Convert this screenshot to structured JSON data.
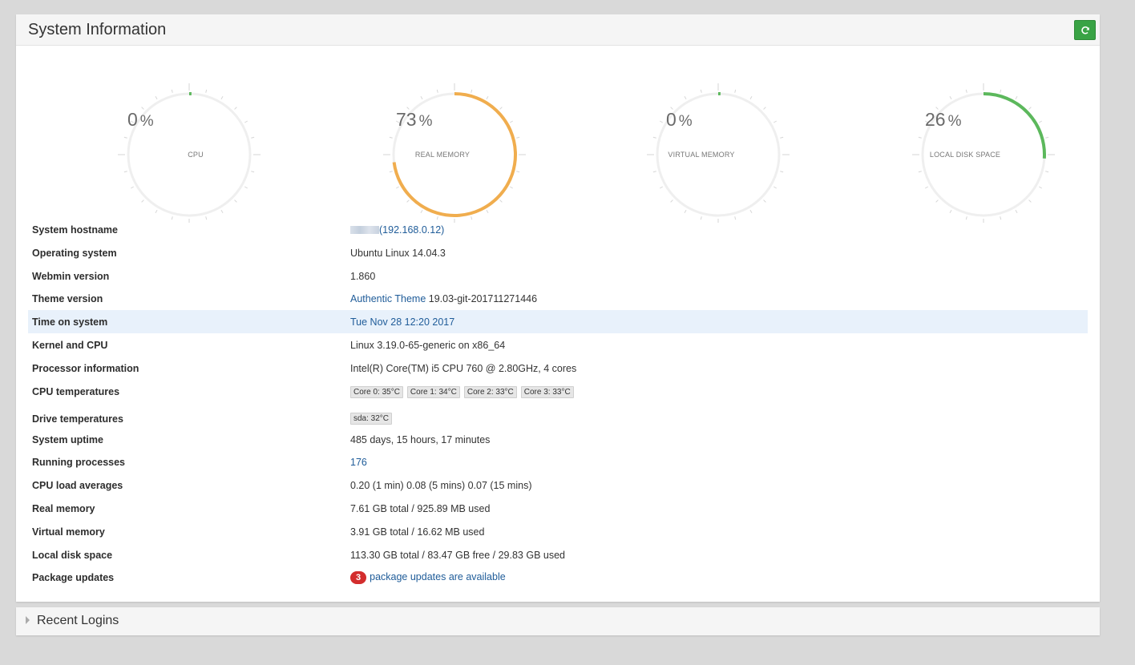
{
  "header": {
    "title": "System Information",
    "refresh_icon": "refresh-icon"
  },
  "colors": {
    "cpu": "#5cb85c",
    "real_memory": "#f0ad4e",
    "virtual_memory": "#5cb85c",
    "disk": "#5cb85c",
    "track": "#efefef",
    "ticks": "#d6d6d6"
  },
  "gauges": [
    {
      "value": "0",
      "unit": "%",
      "label": "CPU",
      "percent": 0
    },
    {
      "value": "73",
      "unit": "%",
      "label": "REAL MEMORY",
      "percent": 73
    },
    {
      "value": "0",
      "unit": "%",
      "label": "VIRTUAL MEMORY",
      "percent": 0
    },
    {
      "value": "26",
      "unit": "%",
      "label": "LOCAL DISK SPACE",
      "percent": 26
    }
  ],
  "info": {
    "hostname": {
      "label": "System hostname",
      "value": "(192.168.0.12)"
    },
    "os": {
      "label": "Operating system",
      "value": "Ubuntu Linux 14.04.3"
    },
    "webmin": {
      "label": "Webmin version",
      "value": "1.860"
    },
    "theme": {
      "label": "Theme version",
      "link": "Authentic Theme",
      "value": "19.03-git-201711271446"
    },
    "time": {
      "label": "Time on system",
      "value": "Tue Nov 28 12:20 2017"
    },
    "kernel": {
      "label": "Kernel and CPU",
      "value": "Linux 3.19.0-65-generic on x86_64"
    },
    "processor": {
      "label": "Processor information",
      "value": "Intel(R) Core(TM) i5 CPU 760 @ 2.80GHz, 4 cores"
    },
    "cpu_temps": {
      "label": "CPU temperatures",
      "values": [
        "Core 0: 35°C",
        "Core 1: 34°C",
        "Core 2: 33°C",
        "Core 3: 33°C"
      ]
    },
    "drive_temps": {
      "label": "Drive temperatures",
      "values": [
        "sda: 32°C"
      ]
    },
    "uptime": {
      "label": "System uptime",
      "value": "485 days, 15 hours, 17 minutes"
    },
    "processes": {
      "label": "Running processes",
      "value": "176"
    },
    "load": {
      "label": "CPU load averages",
      "value": "0.20 (1 min) 0.08 (5 mins) 0.07 (15 mins)"
    },
    "real_memory": {
      "label": "Real memory",
      "value": "7.61 GB total / 925.89 MB used"
    },
    "virtual_memory": {
      "label": "Virtual memory",
      "value": "3.91 GB total / 16.62 MB used"
    },
    "disk": {
      "label": "Local disk space",
      "value": "113.30 GB total / 83.47 GB free / 29.83 GB used"
    },
    "updates": {
      "label": "Package updates",
      "count": "3",
      "value": "package updates are available"
    }
  },
  "recent_logins": {
    "title": "Recent Logins"
  }
}
